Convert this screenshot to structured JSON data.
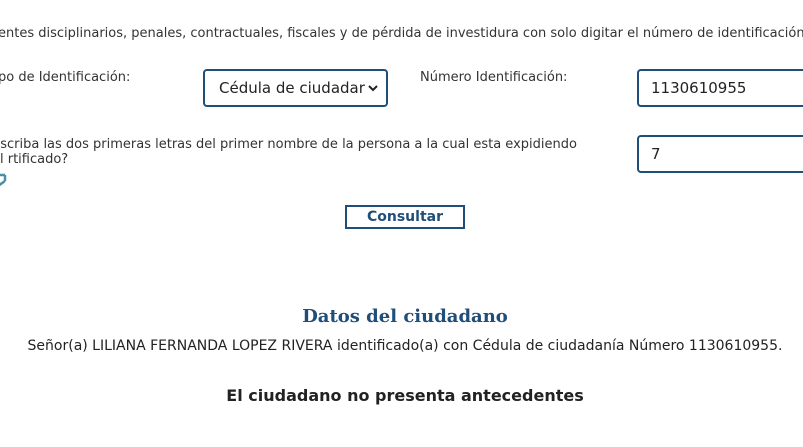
{
  "intro_text": "entes disciplinarios, penales, contractuales, fiscales y de pérdida de investidura con solo digitar el número de identificación de",
  "form": {
    "tipo_label": "po de Identificación:",
    "tipo_selected": "Cédula de ciudadar",
    "numero_label": "Número Identificación:",
    "numero_value": "1130610955",
    "question_label": "Escriba las dos primeras letras del primer nombre de la persona a la cual esta expidiendo el rtificado?",
    "answer_value": "7",
    "refresh_icon": "refresh-icon",
    "consultar_label": "Consultar"
  },
  "results": {
    "title": "Datos del ciudadano",
    "citizen_line": "Señor(a)  LILIANA FERNANDA LOPEZ RIVERA identificado(a) con Cédula de ciudadanía Número 1130610955.",
    "status": "El ciudadano no presenta antecedentes"
  },
  "colors": {
    "accent": "#1f4e79",
    "text": "#333333"
  }
}
